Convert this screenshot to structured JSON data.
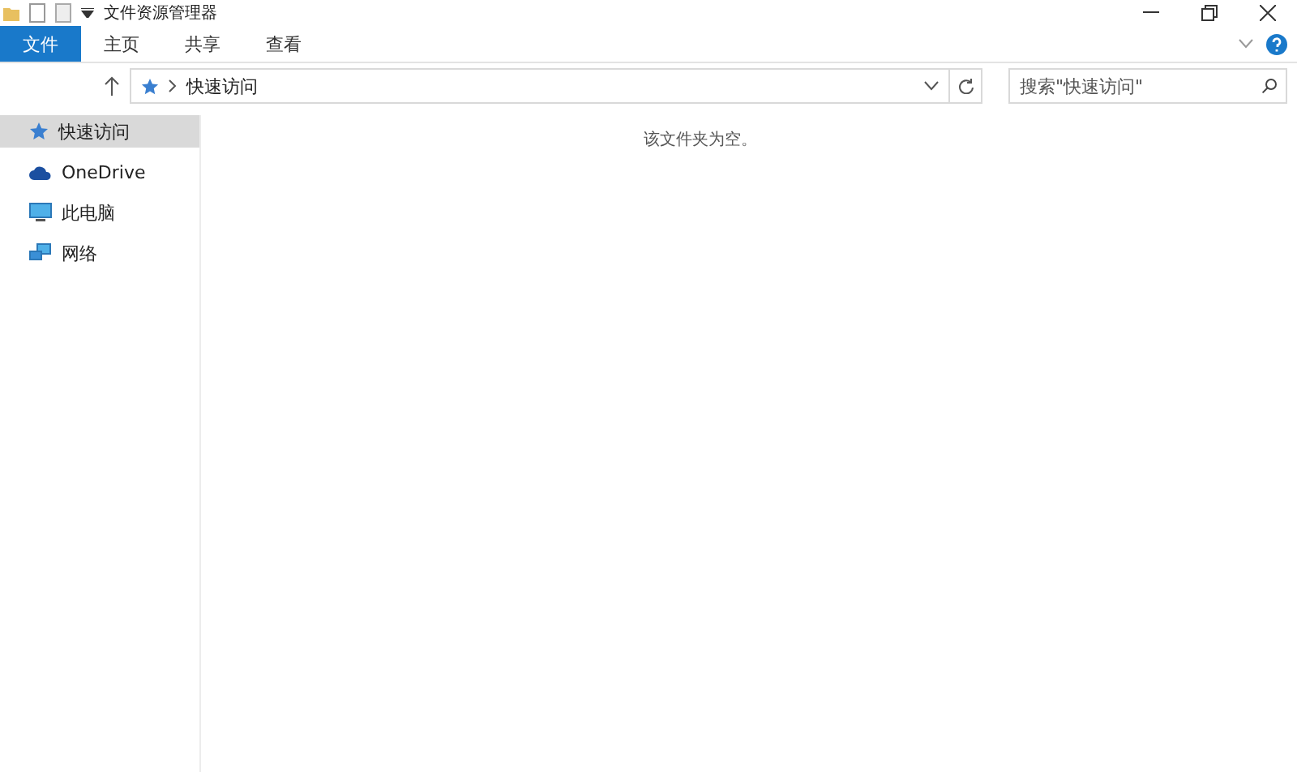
{
  "window": {
    "title": "文件资源管理器"
  },
  "ribbon_tabs": [
    {
      "label": "文件",
      "kind": "file",
      "selected": false
    },
    {
      "label": "主页",
      "kind": "tab",
      "selected": false
    },
    {
      "label": "共享",
      "kind": "tab",
      "selected": false
    },
    {
      "label": "查看",
      "kind": "tab",
      "selected": false
    }
  ],
  "address_bar": {
    "location": "快速访问"
  },
  "search": {
    "placeholder": "搜索\"快速访问\""
  },
  "sidebar": {
    "items": [
      {
        "label": "快速访问",
        "kind": "star",
        "selected": true
      },
      {
        "label": "OneDrive",
        "kind": "cloud",
        "selected": false
      },
      {
        "label": "此电脑",
        "kind": "pc",
        "selected": false
      },
      {
        "label": "网络",
        "kind": "network",
        "selected": false
      }
    ]
  },
  "content": {
    "empty_message": "该文件夹为空。"
  }
}
